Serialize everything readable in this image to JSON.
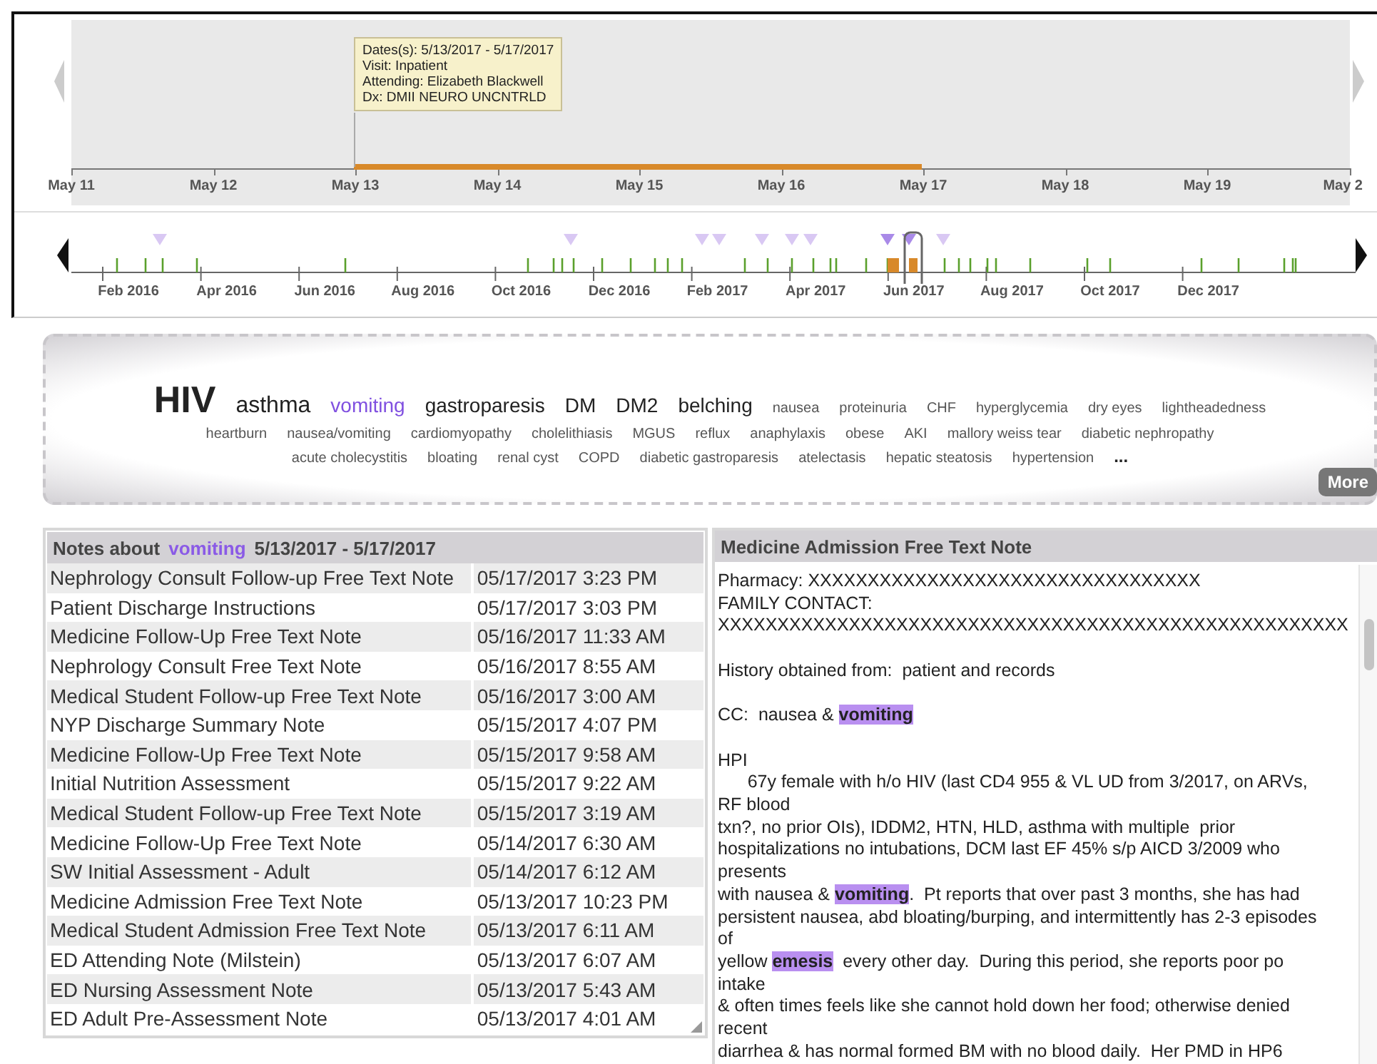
{
  "timeline": {
    "tooltip": [
      "Dates(s): 5/13/2017 - 5/17/2017",
      "Visit: Inpatient",
      "Attending: Elizabeth Blackwell",
      "Dx: DMII NEURO UNCNTRLD"
    ],
    "axis_labels": [
      "May 11",
      "May 12",
      "May 13",
      "May 14",
      "May 15",
      "May 16",
      "May 17",
      "May 18",
      "May 19",
      "May 2"
    ],
    "overview_labels": [
      "Feb 2016",
      "Apr 2016",
      "Jun 2016",
      "Aug 2016",
      "Oct 2016",
      "Dec 2016",
      "Feb 2017",
      "Apr 2017",
      "Jun 2017",
      "Aug 2017",
      "Oct 2017",
      "Dec 2017"
    ]
  },
  "tag_cloud": {
    "lines": [
      {
        "terms": [
          {
            "label": "HIV",
            "kind": "xl",
            "selected": false
          },
          {
            "label": "asthma",
            "kind": "lg",
            "selected": false
          },
          {
            "label": "vomiting",
            "kind": "md",
            "selected": true
          },
          {
            "label": "gastroparesis",
            "kind": "md",
            "selected": false
          },
          {
            "label": "DM",
            "kind": "md",
            "selected": false
          },
          {
            "label": "DM2",
            "kind": "md",
            "selected": false
          },
          {
            "label": "belching",
            "kind": "md",
            "selected": false
          },
          {
            "label": "nausea",
            "kind": "sm",
            "selected": false
          },
          {
            "label": "proteinuria",
            "kind": "sm",
            "selected": false
          },
          {
            "label": "CHF",
            "kind": "sm",
            "selected": false
          },
          {
            "label": "hyperglycemia",
            "kind": "sm",
            "selected": false
          },
          {
            "label": "dry eyes",
            "kind": "sm",
            "selected": false
          },
          {
            "label": "lightheadedness",
            "kind": "sm",
            "selected": false
          }
        ]
      },
      {
        "terms": [
          {
            "label": "heartburn",
            "kind": "sm",
            "selected": false
          },
          {
            "label": "nausea/vomiting",
            "kind": "sm",
            "selected": false
          },
          {
            "label": "cardiomyopathy",
            "kind": "sm",
            "selected": false
          },
          {
            "label": "cholelithiasis",
            "kind": "sm",
            "selected": false
          },
          {
            "label": "MGUS",
            "kind": "sm",
            "selected": false
          },
          {
            "label": "reflux",
            "kind": "sm",
            "selected": false
          },
          {
            "label": "anaphylaxis",
            "kind": "sm",
            "selected": false
          },
          {
            "label": "obese",
            "kind": "sm",
            "selected": false
          },
          {
            "label": "AKI",
            "kind": "sm",
            "selected": false
          },
          {
            "label": "mallory weiss tear",
            "kind": "sm",
            "selected": false
          },
          {
            "label": "diabetic nephropathy",
            "kind": "sm",
            "selected": false
          }
        ]
      },
      {
        "terms": [
          {
            "label": "acute cholecystitis",
            "kind": "sm",
            "selected": false
          },
          {
            "label": "bloating",
            "kind": "sm",
            "selected": false
          },
          {
            "label": "renal cyst",
            "kind": "sm",
            "selected": false
          },
          {
            "label": "COPD",
            "kind": "sm",
            "selected": false
          },
          {
            "label": "diabetic gastroparesis",
            "kind": "sm",
            "selected": false
          },
          {
            "label": "atelectasis",
            "kind": "sm",
            "selected": false
          },
          {
            "label": "hepatic steatosis",
            "kind": "sm",
            "selected": false
          },
          {
            "label": "hypertension",
            "kind": "sm",
            "selected": false
          },
          {
            "label": "...",
            "kind": "more",
            "selected": false
          }
        ]
      }
    ],
    "more_button": "More"
  },
  "notes": {
    "title": "Notes about",
    "term": "vomiting",
    "range": "5/13/2017 - 5/17/2017",
    "rows": [
      {
        "title": "Nephrology Consult Follow-up Free Text Note",
        "date": "05/17/2017 3:23 PM"
      },
      {
        "title": "Patient Discharge Instructions",
        "date": "05/17/2017 3:03 PM"
      },
      {
        "title": "Medicine Follow-Up Free Text Note",
        "date": "05/16/2017 11:33 AM"
      },
      {
        "title": "Nephrology Consult Free Text Note",
        "date": "05/16/2017 8:55 AM"
      },
      {
        "title": "Medical Student Follow-up Free Text Note",
        "date": "05/16/2017 3:00 AM"
      },
      {
        "title": "NYP Discharge Summary Note",
        "date": "05/15/2017 4:07 PM"
      },
      {
        "title": "Medicine Follow-Up Free Text Note",
        "date": "05/15/2017 9:58 AM"
      },
      {
        "title": "Initial Nutrition Assessment",
        "date": "05/15/2017 9:22 AM"
      },
      {
        "title": "Medical Student Follow-up Free Text Note",
        "date": "05/15/2017 3:19 AM"
      },
      {
        "title": "Medicine Follow-Up Free Text Note",
        "date": "05/14/2017 6:30 AM"
      },
      {
        "title": "SW Initial Assessment - Adult",
        "date": "05/14/2017 6:12 AM"
      },
      {
        "title": "Medicine Admission Free Text Note",
        "date": "05/13/2017 10:23 PM"
      },
      {
        "title": "Medical Student Admission Free Text Note",
        "date": "05/13/2017 6:11 AM"
      },
      {
        "title": "ED Attending Note (Milstein)",
        "date": "05/13/2017 6:07 AM"
      },
      {
        "title": "ED Nursing Assessment Note",
        "date": "05/13/2017 5:43 AM"
      },
      {
        "title": "ED Adult Pre-Assessment Note",
        "date": "05/13/2017 4:01 AM"
      }
    ]
  },
  "note_view": {
    "title": "Medicine Admission Free Text Note",
    "paragraphs": [
      [
        "Pharmacy: XXXXXXXXXXXXXXXXXXXXXXXXXXXXXXXXX",
        "FAMILY CONTACT:",
        "XXXXXXXXXXXXXXXXXXXXXXXXXXXXXXXXXXXXXXXXXXXXXXXXXXXXX"
      ],
      [
        "History obtained from:  patient and records"
      ],
      [
        "CC:  nausea & **vomiting**"
      ],
      [
        "HPI",
        "      67y female with h/o HIV (last CD4 955 & VL UD from 3/2017, on ARVs,",
        "RF blood",
        "txn?, no prior OIs), IDDM2, HTN, HLD, asthma with multiple  prior",
        "hospitalizations no intubations, DCM last EF 45% s/p AICD 3/2009 who",
        "presents",
        "with nausea & **vomiting**.  Pt reports that over past 3 months, she has had",
        "persistent nausea, abd bloating/burping, and intermittently has 2-3 episodes",
        "of",
        "yellow **emesis**  every other day.  During this period, she reports poor po",
        "intake",
        "& often times feels like she cannot hold down her food; otherwise denied",
        "recent",
        "diarrhea & has normal formed BM with no blood daily.  Her PMD in HP6"
      ]
    ]
  }
}
